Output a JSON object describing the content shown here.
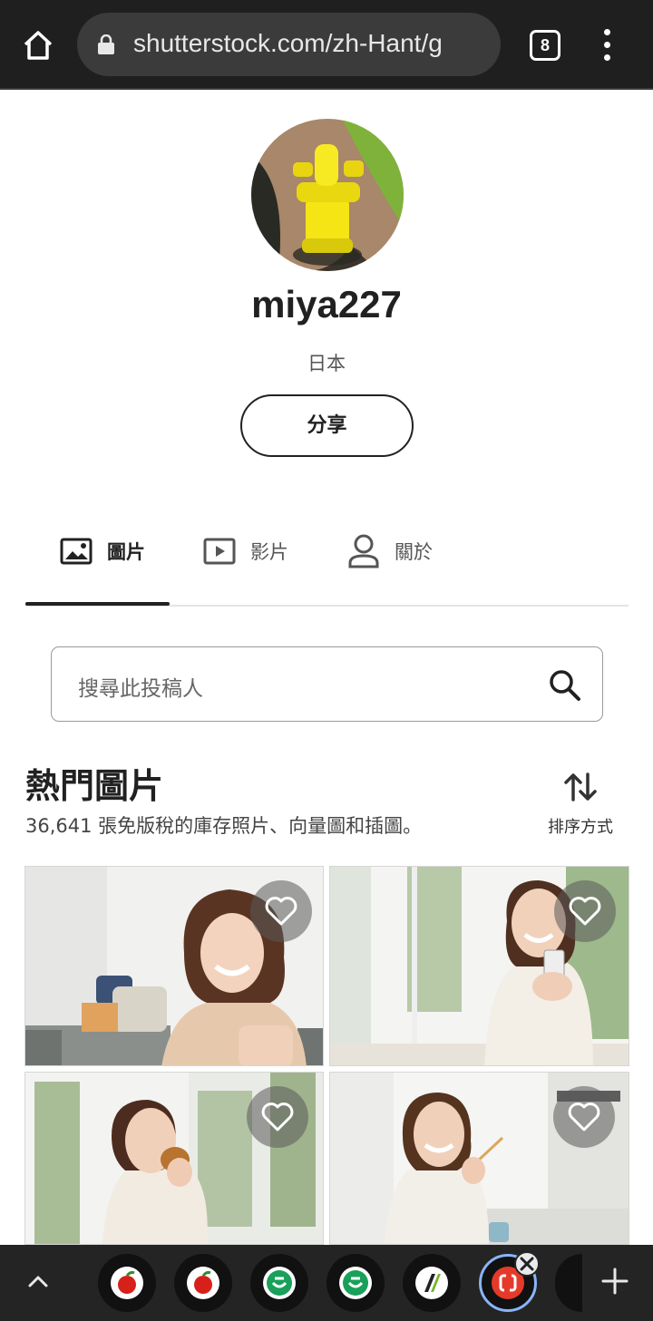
{
  "browser": {
    "url": "shutterstock.com/zh-Hant/g",
    "tab_count": "8",
    "home_icon": "home-icon",
    "lock_icon": "lock-icon",
    "menu_icon": "more-vert-icon"
  },
  "profile": {
    "username": "miya227",
    "location": "日本",
    "share_label": "分享"
  },
  "tabs": [
    {
      "label": "圖片",
      "icon": "image-icon",
      "active": true
    },
    {
      "label": "影片",
      "icon": "video-icon",
      "active": false
    },
    {
      "label": "關於",
      "icon": "person-icon",
      "active": false
    }
  ],
  "search": {
    "placeholder": "搜尋此投稿人"
  },
  "section": {
    "title": "熱門圖片",
    "subtitle": "36,641 張免版稅的庫存照片、向量圖和插圖。",
    "sort_label": "排序方式"
  },
  "photos": [
    {
      "alt": "woman smiling in sweater on sofa"
    },
    {
      "alt": "woman smiling holding smartphone"
    },
    {
      "alt": "woman eating bread by window"
    },
    {
      "alt": "woman eating with fork in kitchen"
    }
  ],
  "bottom_tabs": {
    "count": 7,
    "current_index": 5
  },
  "colors": {
    "topbar": "#1f1f1f",
    "text": "#212121",
    "accent_tab_ring": "#8ab4f8"
  }
}
